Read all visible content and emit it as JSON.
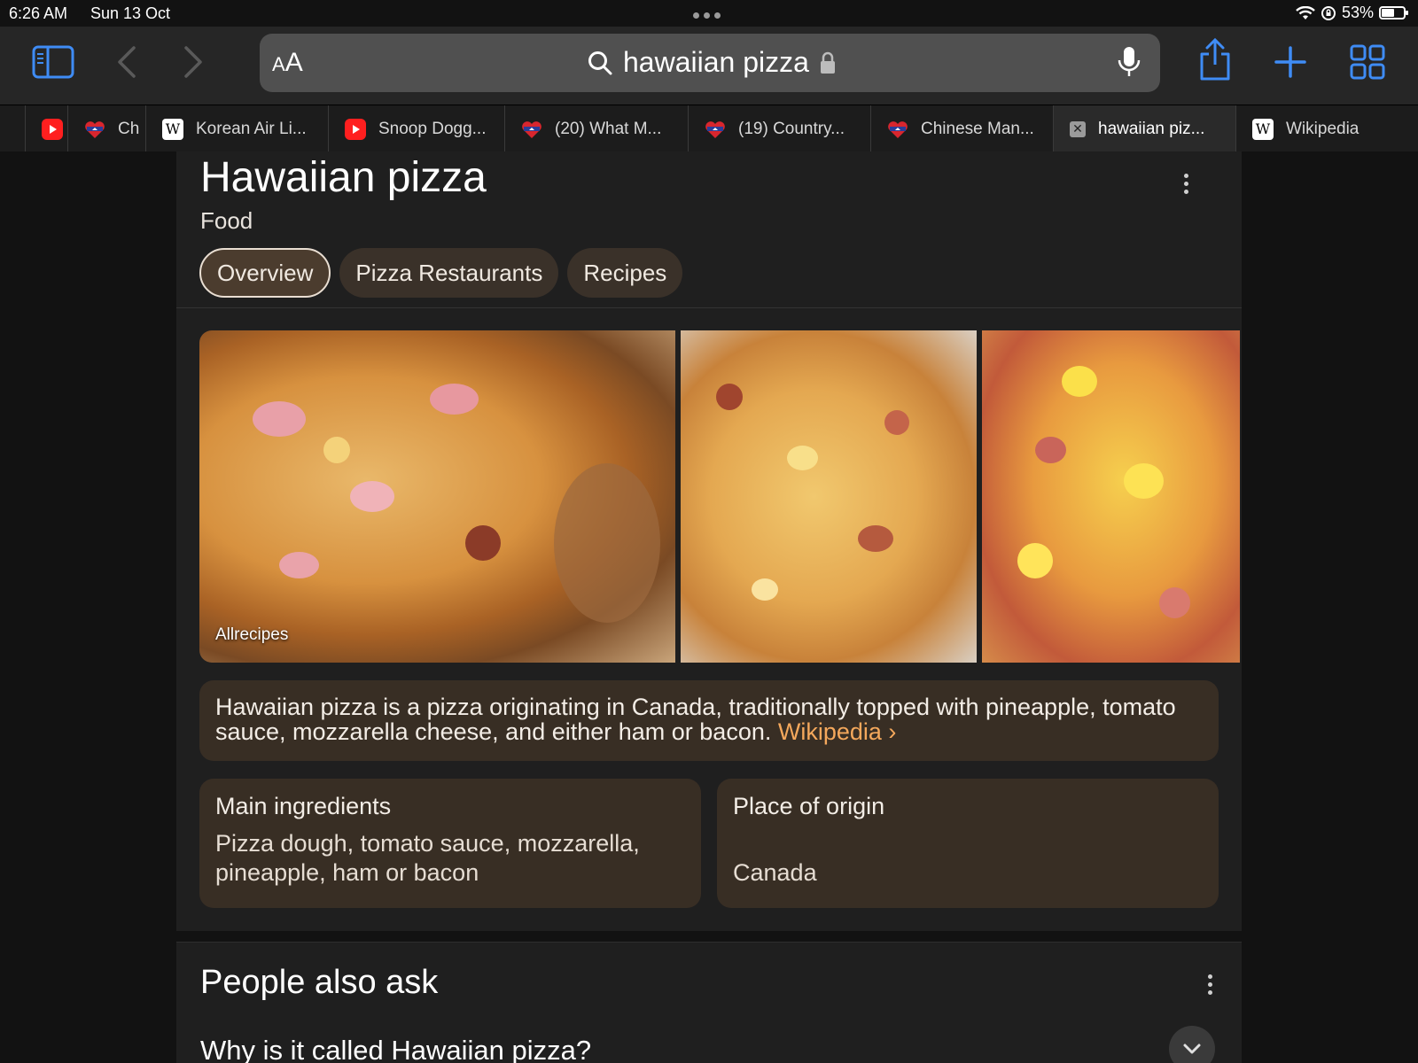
{
  "status_bar": {
    "time": "6:26 AM",
    "date": "Sun 13 Oct",
    "battery": "53%"
  },
  "toolbar": {
    "aa_label_small": "A",
    "aa_label_large": "A",
    "search_query": "hawaiian pizza",
    "icons": [
      "sidebar-icon",
      "back-icon",
      "forward-icon",
      "search-icon",
      "lock-icon",
      "microphone-icon",
      "share-icon",
      "new-tab-icon",
      "tabs-overview-icon"
    ]
  },
  "tabs": [
    {
      "label": "",
      "favicon": "youtube"
    },
    {
      "label": "Ch",
      "favicon": "heart"
    },
    {
      "label": "Korean Air Li...",
      "favicon": "wikipedia"
    },
    {
      "label": "Snoop Dogg...",
      "favicon": "youtube"
    },
    {
      "label": "(20) What M...",
      "favicon": "heart"
    },
    {
      "label": "(19) Country...",
      "favicon": "heart"
    },
    {
      "label": "Chinese Man...",
      "favicon": "heart"
    },
    {
      "label": "hawaiian piz...",
      "favicon": "close",
      "active": true
    },
    {
      "label": "Wikipedia",
      "favicon": "wikipedia"
    }
  ],
  "knowledge_panel": {
    "title": "Hawaiian pizza",
    "subtitle": "Food",
    "chips": [
      "Overview",
      "Pizza Restaurants",
      "Recipes"
    ],
    "image_credit": "Allrecipes",
    "description": "Hawaiian pizza is a pizza originating in Canada, traditionally topped with pineapple, tomato sauce, mozzarella cheese, and either ham or bacon.",
    "description_link": "Wikipedia ›",
    "facts": [
      {
        "label": "Main ingredients",
        "value": "Pizza dough, tomato sauce, mozzarella, pineapple, ham or bacon"
      },
      {
        "label": "Place of origin",
        "value": "Canada"
      }
    ]
  },
  "people_also_ask": {
    "heading": "People also ask",
    "questions": [
      "Why is it called Hawaiian pizza?"
    ]
  },
  "colors": {
    "accent": "#3f8cf5",
    "link": "#f4a85c",
    "chip_bg": "#3a3129",
    "card_bg": "#382e24"
  }
}
